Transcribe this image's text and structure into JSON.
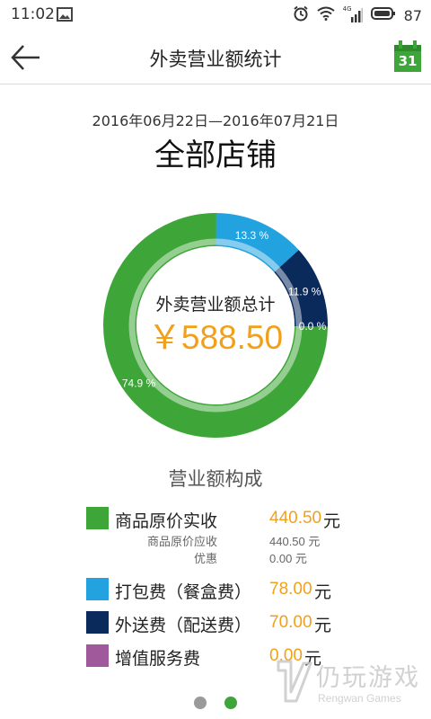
{
  "status_bar": {
    "time": "11:02",
    "battery": "87",
    "network": "4G",
    "icons": [
      "image-icon",
      "alarm-icon",
      "wifi-icon",
      "signal-icon",
      "battery-icon"
    ]
  },
  "app_bar": {
    "title": "外卖营业额统计",
    "calendar_day": "31",
    "icons": [
      "back-arrow-icon",
      "calendar-icon"
    ]
  },
  "summary": {
    "date_range": "2016年06月22日—2016年07月21日",
    "store": "全部店铺",
    "total_label": "外卖营业额总计",
    "total_value": "￥588.50"
  },
  "colors": {
    "green": "#3ea638",
    "light_blue": "#22a3e0",
    "navy": "#0a2a5c",
    "purple": "#a05a9b",
    "orange": "#f2a019"
  },
  "chart_data": {
    "type": "pie",
    "style": "donut",
    "slices": [
      {
        "label": "商品原价实收",
        "percent": 74.9,
        "percent_label": "74.9 %",
        "color": "#3ea638"
      },
      {
        "label": "打包费（餐盒费）",
        "percent": 13.3,
        "percent_label": "13.3 %",
        "color": "#22a3e0"
      },
      {
        "label": "外送费（配送费）",
        "percent": 11.9,
        "percent_label": "11.9 %",
        "color": "#0a2a5c"
      },
      {
        "label": "增值服务费",
        "percent": 0.0,
        "percent_label": "0.0 %",
        "color": "#a05a9b"
      }
    ]
  },
  "breakdown": {
    "title": "营业额构成",
    "unit": "元",
    "items": [
      {
        "label": "商品原价实收",
        "amount": "440.50",
        "color": "#3ea638"
      },
      {
        "label": "打包费（餐盒费）",
        "amount": "78.00",
        "color": "#22a3e0"
      },
      {
        "label": "外送费（配送费）",
        "amount": "70.00",
        "color": "#0a2a5c"
      },
      {
        "label": "增值服务费",
        "amount": "0.00",
        "color": "#a05a9b"
      }
    ],
    "sub_items": [
      {
        "label": "商品原价应收",
        "value": "440.50 元"
      },
      {
        "label": "优惠",
        "value": "0.00 元"
      }
    ]
  },
  "pager": {
    "pages": 2,
    "active": 1
  },
  "watermark": {
    "cn": "仍玩游戏",
    "en": "Rengwan Games"
  }
}
